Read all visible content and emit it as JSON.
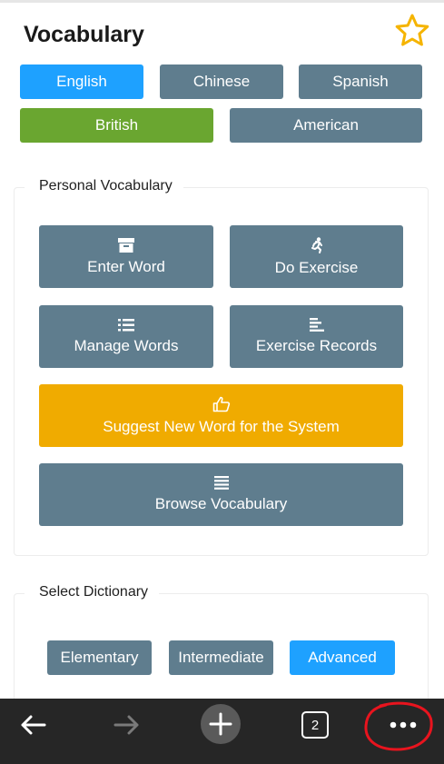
{
  "header": {
    "title": "Vocabulary"
  },
  "languages": {
    "english": "English",
    "chinese": "Chinese",
    "spanish": "Spanish"
  },
  "dialects": {
    "british": "British",
    "american": "American"
  },
  "personal": {
    "heading": "Personal Vocabulary",
    "enter_word": "Enter Word",
    "do_exercise": "Do Exercise",
    "manage_words": "Manage Words",
    "exercise_records": "Exercise Records",
    "suggest_word": "Suggest New Word for the System",
    "browse_vocabulary": "Browse Vocabulary"
  },
  "dictionary": {
    "heading": "Select Dictionary",
    "elementary": "Elementary",
    "intermediate": "Intermediate",
    "advanced": "Advanced"
  },
  "browser": {
    "tab_count": "2"
  },
  "colors": {
    "active_blue": "#1ea1ff",
    "active_green": "#6aa630",
    "button_slate": "#5f7d8e",
    "suggest_amber": "#f0ab00",
    "star_outline": "#f5b400",
    "bottom_bar": "#262626",
    "annotation_red": "#e8141e"
  },
  "icons": {
    "favorite": "star-outline-icon",
    "enter_word": "archive-box-icon",
    "do_exercise": "running-person-icon",
    "manage_words": "list-bullets-icon",
    "exercise_records": "align-left-icon",
    "suggest_word": "thumbs-up-icon",
    "browse_vocabulary": "lines-icon",
    "back": "arrow-left-icon",
    "forward": "arrow-right-icon",
    "new_tab": "plus-icon",
    "menu": "more-horizontal-icon"
  }
}
